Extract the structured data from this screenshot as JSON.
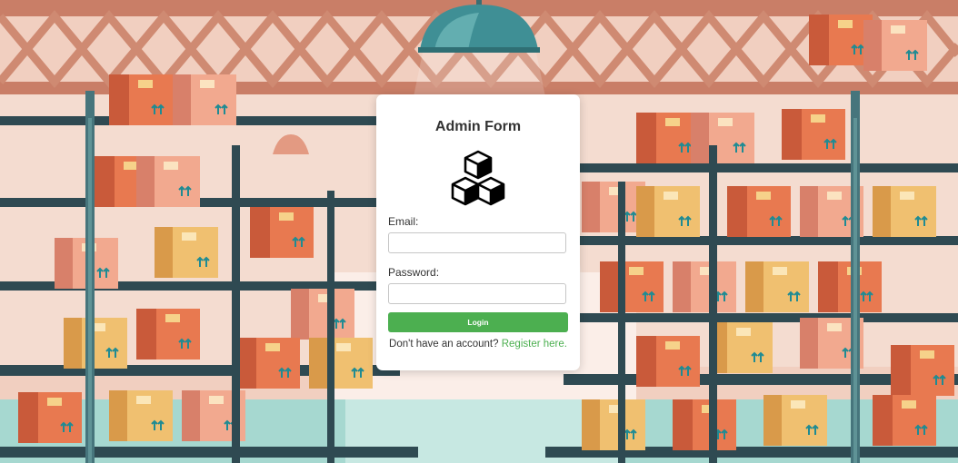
{
  "colors": {
    "accent": "#4caf50",
    "card_bg": "#ffffff",
    "text": "#333333"
  },
  "background": {
    "scene": "warehouse-shelves-with-boxes"
  },
  "form": {
    "title": "Admin Form",
    "logo_icon": "boxes-icon",
    "email_label": "Email:",
    "email_value": "",
    "password_label": "Password:",
    "password_value": "",
    "login_label": "Login",
    "register_prompt": "Don't have an account?",
    "register_link": "Register here."
  }
}
